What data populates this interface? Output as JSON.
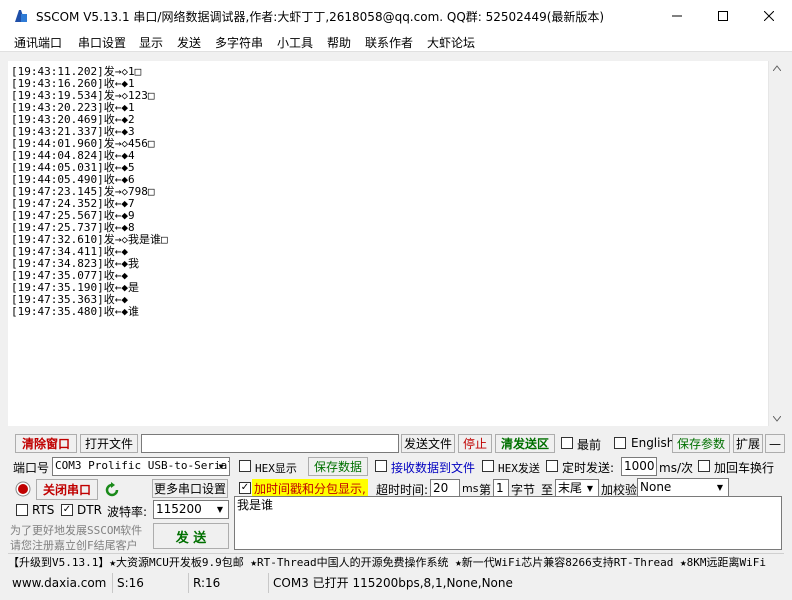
{
  "window": {
    "title": "SSCOM V5.13.1 串口/网络数据调试器,作者:大虾丁丁,2618058@qq.com. QQ群: 52502449(最新版本)",
    "icon": "sscom-app-icon"
  },
  "menu": [
    "通讯端口",
    "串口设置",
    "显示",
    "发送",
    "多字符串",
    "小工具",
    "帮助",
    "联系作者",
    "大虾论坛"
  ],
  "log": [
    "[19:43:11.202]发→◇1□",
    "[19:43:16.260]收←◆1",
    "[19:43:19.534]发→◇123□",
    "[19:43:20.223]收←◆1",
    "[19:43:20.469]收←◆2",
    "[19:43:21.337]收←◆3",
    "[19:44:01.960]发→◇456□",
    "[19:44:04.824]收←◆4",
    "[19:44:05.031]收←◆5",
    "[19:44:05.490]收←◆6",
    "[19:47:23.145]发→◇798□",
    "[19:47:24.352]收←◆7",
    "[19:47:25.567]收←◆9",
    "[19:47:25.737]收←◆8",
    "[19:47:32.610]发→◇我是谁□",
    "[19:47:34.411]收←◆",
    "[19:47:34.823]收←◆我",
    "[19:47:35.077]收←◆",
    "[19:47:35.190]收←◆是",
    "[19:47:35.363]收←◆",
    "[19:47:35.480]收←◆谁"
  ],
  "toolbar": {
    "clear_window": "清除窗口",
    "open_file": "打开文件",
    "send_file": "发送文件",
    "stop": "停止",
    "clear_send": "清发送区",
    "last": "最前",
    "english": "English",
    "save_params": "保存参数",
    "expand": "扩展",
    "collapse": "—"
  },
  "port": {
    "label": "端口号",
    "value": "COM3 Prolific USB-to-Serial",
    "close_port": "关闭串口",
    "more_settings": "更多串口设置",
    "rts": "RTS",
    "dtr": "DTR",
    "baud_label": "波特率:",
    "baud_value": "115200"
  },
  "options": {
    "hex_display": "HEX显示",
    "save_data": "保存数据",
    "recv_to_file": "接收数据到文件",
    "hex_send": "HEX发送",
    "timed_send": "定时发送:",
    "interval": "1000",
    "interval_unit": "ms/次",
    "add_crlf": "加回车换行",
    "timestamp": "加时间戳和分包显示,",
    "timeout_label": "超时时间:",
    "timeout_value": "20",
    "timeout_unit": "ms",
    "byte_prefix": "第",
    "byte_index": "1",
    "byte_unit": "字节",
    "to_label": "至",
    "to_value": "末尾",
    "checksum_label": "加校验",
    "checksum_value": "None"
  },
  "send": {
    "text": "我是谁",
    "button": "发 送"
  },
  "promo": {
    "line1": "为了更好地发展SSCOM软件",
    "line2": "请您注册嘉立创F结尾客户"
  },
  "ticker": "【升级到V5.13.1】★大资源MCU开发板9.9包邮 ★RT-Thread中国人的开源免费操作系统 ★新一代WiFi芯片兼容8266支持RT-Thread ★8KM远距离WiFi",
  "status": {
    "website": "www.daxia.com",
    "sent": "S:16",
    "received": "R:16",
    "port_info": "COM3 已打开  115200bps,8,1,None,None"
  },
  "colors": {
    "accent_red": "#c00000",
    "accent_green": "#007000",
    "highlight_yellow": "#ffff00"
  }
}
